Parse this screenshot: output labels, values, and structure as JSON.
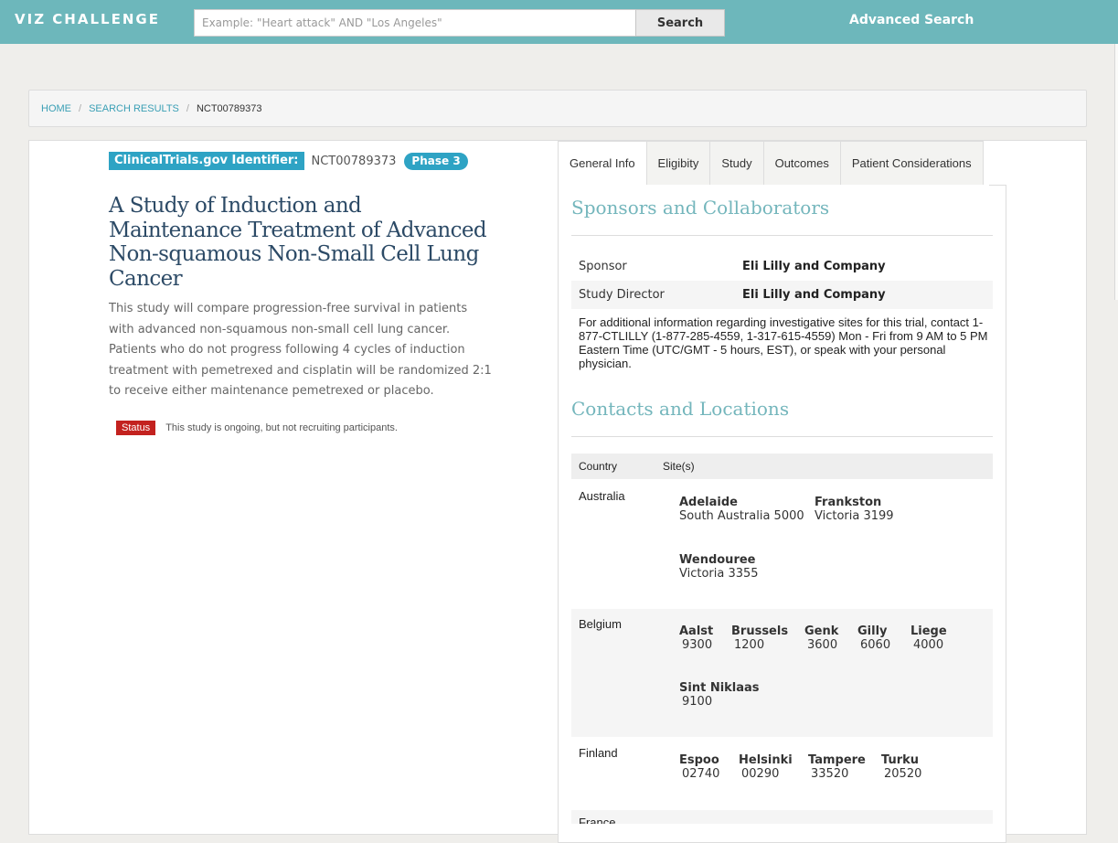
{
  "header": {
    "logo": "VIZ CHALLENGE",
    "search_placeholder": "Example: \"Heart attack\" AND \"Los Angeles\"",
    "search_button": "Search",
    "advanced_search": "Advanced Search"
  },
  "breadcrumb": {
    "home": "HOME",
    "sep": "/",
    "results": "SEARCH RESULTS",
    "current": "NCT00789373"
  },
  "study": {
    "id_label": "ClinicalTrials.gov Identifier:",
    "id_value": "NCT00789373",
    "phase": "Phase 3",
    "title": "A Study of Induction and Maintenance Treatment of Advanced Non-squamous Non-Small Cell Lung Cancer",
    "summary_1": "This study will compare progression-free survival in patients with advanced non-squamous non-small cell lung cancer.",
    "summary_2": "Patients who do not progress following 4 cycles of induction treatment with pemetrexed and cisplatin will be randomized 2:1 to receive either maintenance pemetrexed or placebo.",
    "status_label": "Status",
    "status_text": "This study is ongoing, but not recruiting participants."
  },
  "tabs": [
    "General Info",
    "Eligibity",
    "Study",
    "Outcomes",
    "Patient Considerations"
  ],
  "sponsors": {
    "heading": "Sponsors and Collaborators",
    "sponsor_label": "Sponsor",
    "sponsor_value": "Eli Lilly and Company",
    "director_label": "Study Director",
    "director_value": "Eli Lilly and Company",
    "note": "For additional information regarding investigative sites for this trial, contact 1-877-CTLILLY (1-877-285-4559, 1-317-615-4559) Mon - Fri from 9 AM to 5 PM Eastern Time (UTC/GMT - 5 hours, EST), or speak with your personal physician."
  },
  "locations": {
    "heading": "Contacts and Locations",
    "col_country": "Country",
    "col_sites": "Site(s)",
    "countries": [
      {
        "name": "Australia",
        "sites": [
          {
            "city": "Adelaide",
            "region": "South Australia 5000"
          },
          {
            "city": "Frankston",
            "region": "Victoria 3199"
          },
          {
            "city": "Wendouree",
            "region": "Victoria 3355"
          }
        ]
      },
      {
        "name": "Belgium",
        "sites": [
          {
            "city": "Aalst",
            "region": "9300"
          },
          {
            "city": "Brussels",
            "region": "1200"
          },
          {
            "city": "Genk",
            "region": "3600"
          },
          {
            "city": "Gilly",
            "region": "6060"
          },
          {
            "city": "Liege",
            "region": "4000"
          },
          {
            "city": "Sint Niklaas",
            "region": "9100"
          }
        ]
      },
      {
        "name": "Finland",
        "sites": [
          {
            "city": "Espoo",
            "region": "02740"
          },
          {
            "city": "Helsinki",
            "region": "00290"
          },
          {
            "city": "Tampere",
            "region": "33520"
          },
          {
            "city": "Turku",
            "region": "20520"
          }
        ]
      },
      {
        "name": "France",
        "sites": []
      }
    ]
  }
}
